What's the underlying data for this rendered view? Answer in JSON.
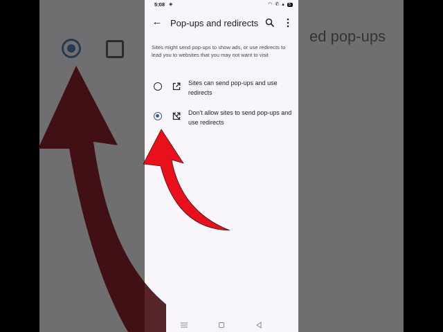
{
  "backdrop": {
    "partial_text": "ed pop-ups"
  },
  "status_bar": {
    "time": "5:08",
    "battery": "5"
  },
  "app_bar": {
    "title": "Pop-ups and redirects",
    "back_icon": "arrow-left-icon",
    "search_icon": "search-icon",
    "more_icon": "more-vert-icon"
  },
  "description": "Sites might send pop-ups to show ads, or use redirects to lead you to websites that you may not want to visit",
  "options": [
    {
      "label": "Sites can send pop-ups and use redirects",
      "icon": "open-in-new-icon",
      "selected": false
    },
    {
      "label": "Don't allow sites to send pop-ups and use redirects",
      "icon": "block-popup-icon",
      "selected": true
    }
  ],
  "colors": {
    "accent": "#3b5b93",
    "arrow": "#e8101a",
    "screen_bg": "#f8f6fb"
  }
}
